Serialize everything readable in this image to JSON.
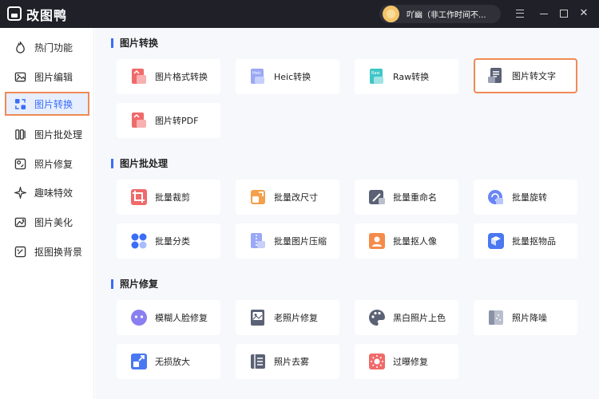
{
  "app": {
    "title": "改图鸭",
    "user_name": "吖幽（非工作时间不..."
  },
  "colors": {
    "accent": "#3b6df6",
    "highlight_border": "#f08a55",
    "titlebar": "#1f2028"
  },
  "sidebar": {
    "items": [
      {
        "label": "热门功能",
        "icon": "flame-icon"
      },
      {
        "label": "图片编辑",
        "icon": "image-edit-icon"
      },
      {
        "label": "图片转换",
        "icon": "convert-icon",
        "active": true
      },
      {
        "label": "图片批处理",
        "icon": "batch-icon"
      },
      {
        "label": "照片修复",
        "icon": "photo-repair-icon"
      },
      {
        "label": "趣味特效",
        "icon": "sparkle-icon"
      },
      {
        "label": "图片美化",
        "icon": "beautify-icon"
      },
      {
        "label": "抠图换背景",
        "icon": "cutout-icon"
      }
    ]
  },
  "sections": [
    {
      "title": "图片转换",
      "cards": [
        {
          "label": "图片格式转换",
          "icon": "format-convert-icon"
        },
        {
          "label": "Heic转换",
          "icon": "heic-icon"
        },
        {
          "label": "Raw转换",
          "icon": "raw-icon"
        },
        {
          "label": "图片转文字",
          "icon": "image-to-text-icon",
          "selected": true
        },
        {
          "label": "图片转PDF",
          "icon": "image-to-pdf-icon"
        }
      ]
    },
    {
      "title": "图片批处理",
      "cards": [
        {
          "label": "批量裁剪",
          "icon": "crop-icon"
        },
        {
          "label": "批量改尺寸",
          "icon": "resize-icon"
        },
        {
          "label": "批量重命名",
          "icon": "rename-icon"
        },
        {
          "label": "批量旋转",
          "icon": "rotate-icon"
        },
        {
          "label": "批量分类",
          "icon": "classify-icon"
        },
        {
          "label": "批量图片压缩",
          "icon": "compress-icon"
        },
        {
          "label": "批量抠人像",
          "icon": "portrait-cutout-icon"
        },
        {
          "label": "批量抠物品",
          "icon": "object-cutout-icon"
        }
      ]
    },
    {
      "title": "照片修复",
      "cards": [
        {
          "label": "模糊人脸修复",
          "icon": "face-repair-icon"
        },
        {
          "label": "老照片修复",
          "icon": "old-photo-icon"
        },
        {
          "label": "黑白照片上色",
          "icon": "palette-icon"
        },
        {
          "label": "照片降噪",
          "icon": "denoise-icon"
        },
        {
          "label": "无损放大",
          "icon": "upscale-icon"
        },
        {
          "label": "照片去雾",
          "icon": "dehaze-icon"
        },
        {
          "label": "过曝修复",
          "icon": "exposure-icon"
        }
      ]
    }
  ]
}
